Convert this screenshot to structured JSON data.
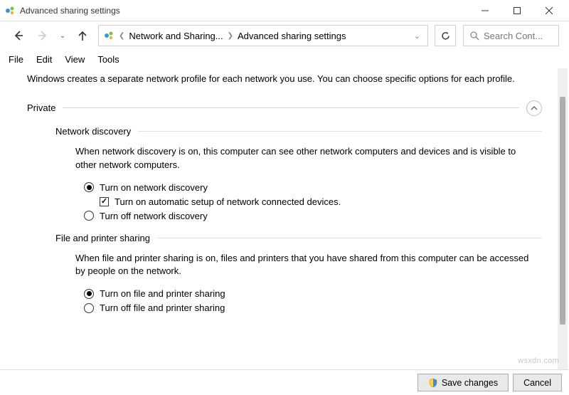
{
  "window": {
    "title": "Advanced sharing settings"
  },
  "breadcrumb": {
    "item1": "Network and Sharing...",
    "item2": "Advanced sharing settings"
  },
  "search": {
    "placeholder": "Search Cont..."
  },
  "menu": {
    "file": "File",
    "edit": "Edit",
    "view": "View",
    "tools": "Tools"
  },
  "intro": "Windows creates a separate network profile for each network you use. You can choose specific options for each profile.",
  "section_private": {
    "label": "Private"
  },
  "network_discovery": {
    "heading": "Network discovery",
    "desc": "When network discovery is on, this computer can see other network computers and devices and is visible to other network computers.",
    "opt_on": "Turn on network discovery",
    "opt_auto": "Turn on automatic setup of network connected devices.",
    "opt_off": "Turn off network discovery"
  },
  "file_printer": {
    "heading": "File and printer sharing",
    "desc": "When file and printer sharing is on, files and printers that you have shared from this computer can be accessed by people on the network.",
    "opt_on": "Turn on file and printer sharing",
    "opt_off": "Turn off file and printer sharing"
  },
  "footer": {
    "save": "Save changes",
    "cancel": "Cancel"
  },
  "watermark": "wsxdn.com"
}
